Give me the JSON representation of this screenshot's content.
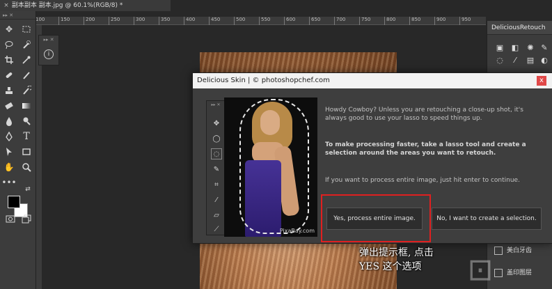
{
  "document": {
    "tab_title": "副本副本 副本.jpg @ 60.1%(RGB/8) *",
    "close_glyph": "×"
  },
  "ruler": {
    "ticks": [
      "100",
      "150",
      "200",
      "250",
      "300",
      "350",
      "400",
      "450",
      "500",
      "550",
      "600",
      "650",
      "700",
      "750",
      "800",
      "850",
      "900",
      "950"
    ]
  },
  "toolbar": {
    "grip": "▸▸ ✕",
    "tools": [
      "move",
      "marquee",
      "lasso",
      "quick-selection",
      "crop",
      "eyedropper",
      "healing-brush",
      "brush",
      "clone-stamp",
      "history-brush",
      "eraser",
      "gradient",
      "blur",
      "dodge",
      "pen",
      "type",
      "path-selection",
      "rectangle",
      "hand",
      "zoom",
      "more"
    ]
  },
  "info_panel": {
    "grip": "▸▸ ✕"
  },
  "right_panel": {
    "title": "DeliciousRetouch",
    "rows": [
      {
        "label": "美白牙齿"
      },
      {
        "label": "盖印图层"
      }
    ]
  },
  "dialog": {
    "title": "Delicious Skin | © photoshopchef.com",
    "close_label": "x",
    "para1": "Howdy Cowboy? Unless you are retouching a close-up shot, it's always good to use your lasso to speed things up.",
    "para2": "To make processing faster, take a lasso tool and create a selection around the areas you want to retouch.",
    "para3": "If you want to process entire image, just hit enter to continue.",
    "yes_button": "Yes, process entire image.",
    "no_button": "No, I want to create a selection.",
    "preview_credit": "PixaBay.com",
    "mini_grip": "▸▸ ✕"
  },
  "annotation": {
    "line1": "弹出提示框, 点击",
    "line2": "YES 这个选项"
  },
  "colors": {
    "accent_red": "#e02020",
    "background": "#282828",
    "panel": "#3c3c3c"
  }
}
